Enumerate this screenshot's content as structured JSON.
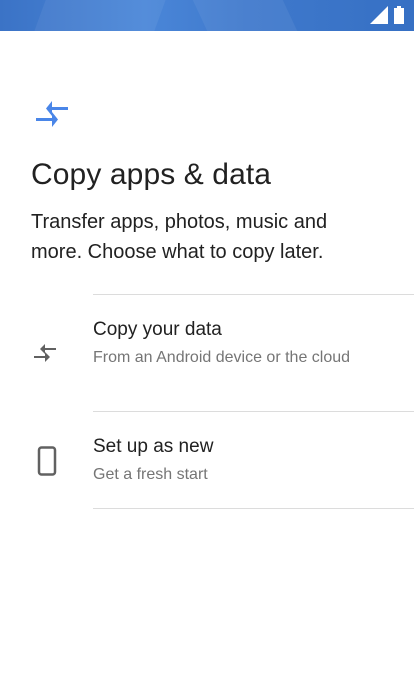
{
  "screen": {
    "title": "Copy apps & data",
    "subtitle": "Transfer apps, photos, music and more. Choose what to copy later."
  },
  "options": [
    {
      "title": "Copy your data",
      "subtitle": "From an Android device or the cloud",
      "icon": "transfer-arrows-icon"
    },
    {
      "title": "Set up as new",
      "subtitle": "Get a fresh start",
      "icon": "phone-icon"
    }
  ],
  "colors": {
    "status_bar": "#3f79cc",
    "accent": "#4a86e8",
    "icon_gray": "#616161"
  }
}
